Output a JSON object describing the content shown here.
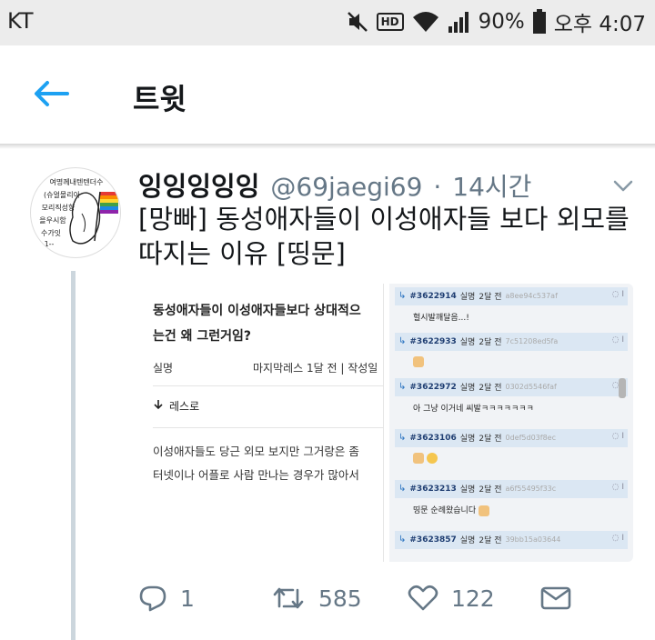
{
  "status_bar": {
    "carrier": "KT",
    "battery": "90%",
    "hd_label": "HD",
    "time": "오후 4:07",
    "icons": [
      "mute-icon",
      "hd-icon",
      "wifi-icon",
      "signal-icon",
      "battery-icon"
    ]
  },
  "header": {
    "title": "트윗",
    "back_icon": "arrow-left-icon"
  },
  "tweet": {
    "author_name": "잉잉잉잉잉",
    "handle": "@69jaegi69",
    "separator": "·",
    "time": "14시간",
    "text": "[망빠] 동성애자들이 이성애자들 보다 외모를 따지는 이유 [띵문]",
    "avatar_text": [
      "여명께내텐텐더수",
      "(슈얼몰리아",
      "모리직성향",
      "을우시함",
      "수가잇",
      "1--"
    ],
    "media": {
      "left": {
        "title_lines": [
          "동성애자들이 이성애자들보다 상대적으",
          "는건 왜 그런거임?"
        ],
        "meta_author": "실명",
        "meta_info": "마지막레스 1달 전 | 작성일",
        "reply_label": "레스로",
        "body_lines": [
          "이성애자들도 당근 외모 보지만 그거랑은 좀",
          "터넷이나 어플로 사람 만나는 경우가 많아서"
        ]
      },
      "right": {
        "comments": [
          {
            "id": "#3622914",
            "author": "실명",
            "time": "2달 전",
            "hash": "a8ee94c537af",
            "body": "헐시발깨달음...!"
          },
          {
            "id": "#3622933",
            "author": "실명",
            "time": "2달 전",
            "hash": "7c51208ed5fa",
            "body": ""
          },
          {
            "id": "#3622972",
            "author": "실명",
            "time": "2달 전",
            "hash": "0302d5546faf",
            "body": "아 그냥 이거네 씨발ㅋㅋㅋㅋㅋㅋㅋ"
          },
          {
            "id": "#3623106",
            "author": "실명",
            "time": "2달 전",
            "hash": "0def5d03f8ec",
            "body": ""
          },
          {
            "id": "#3623213",
            "author": "실명",
            "time": "2달 전",
            "hash": "a6f55495f33c",
            "body": "띵문 순례왔습니다"
          },
          {
            "id": "#3623857",
            "author": "실명",
            "time": "2달 전",
            "hash": "39bb15a03644",
            "body": ""
          }
        ]
      }
    },
    "actions": {
      "reply_count": "1",
      "retweet_count": "585",
      "like_count": "122"
    }
  }
}
